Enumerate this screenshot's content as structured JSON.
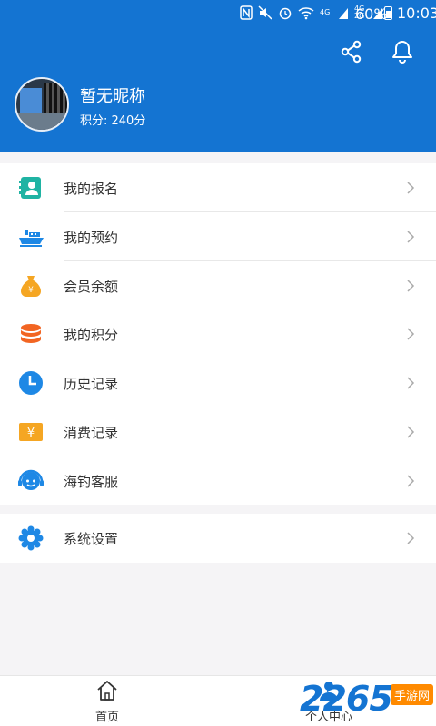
{
  "status_bar": {
    "battery": "60%",
    "time": "10:03",
    "network_a": "4G",
    "network_b": "4G 2G"
  },
  "header": {
    "nickname": "暂无昵称",
    "points": "积分: 240分",
    "icons": [
      "share-icon",
      "bell-icon"
    ]
  },
  "menu": {
    "items": [
      {
        "label": "我的报名",
        "icon": "registration-icon",
        "color": "#1fb3a3"
      },
      {
        "label": "我的预约",
        "icon": "boat-icon",
        "color": "#1e88e5"
      },
      {
        "label": "会员余额",
        "icon": "money-bag-icon",
        "color": "#f5a623"
      },
      {
        "label": "我的积分",
        "icon": "coins-icon",
        "color": "#f26522"
      },
      {
        "label": "历史记录",
        "icon": "clock-icon",
        "color": "#1e88e5"
      },
      {
        "label": "消费记录",
        "icon": "yen-icon",
        "color": "#f5a623"
      },
      {
        "label": "海钓客服",
        "icon": "headset-icon",
        "color": "#1e88e5"
      }
    ],
    "settings": {
      "label": "系统设置",
      "icon": "settings-icon",
      "color": "#1e88e5"
    }
  },
  "tabbar": {
    "home": "首页",
    "me": "个人中心"
  },
  "watermark": {
    "number": "2265",
    "suffix": "手游网"
  }
}
